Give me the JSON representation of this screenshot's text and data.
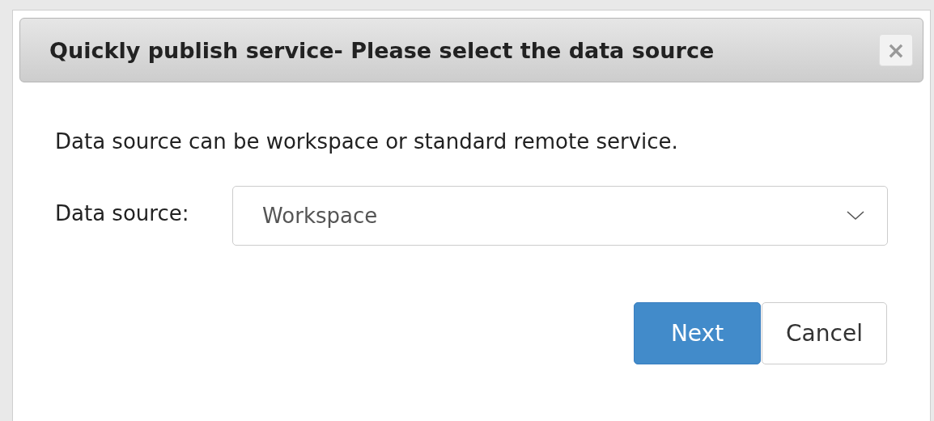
{
  "dialog": {
    "title": "Quickly publish service- Please select the data source",
    "close": "×"
  },
  "description": "Data source can be workspace or standard remote service.",
  "data_source": {
    "label": "Data source:",
    "value": "Workspace"
  },
  "buttons": [
    {
      "label": "Next",
      "kind": "primary"
    },
    {
      "label": "Cancel",
      "kind": "default"
    }
  ]
}
